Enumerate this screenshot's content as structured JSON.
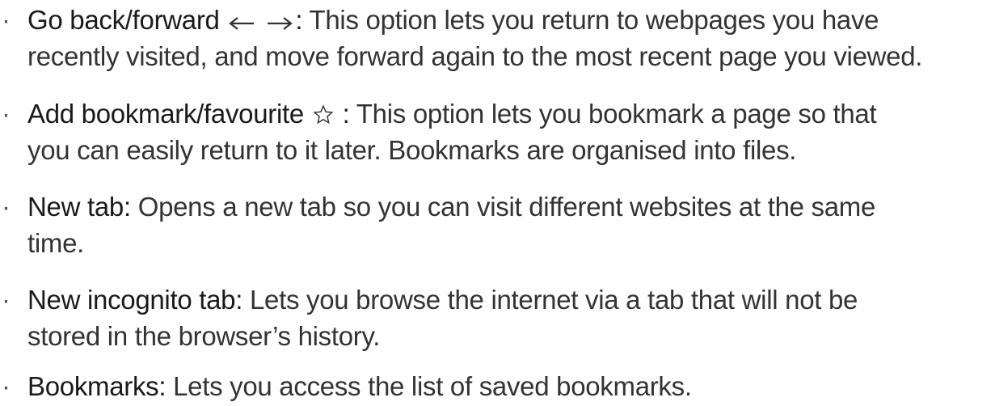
{
  "items": [
    {
      "bullet": "·",
      "term": "Go back/forward",
      "colon": ":",
      "line1": "This option lets you return to webpages you have",
      "line2": "recently visited, and move forward again to the most recent page you viewed.",
      "icons": [
        "arrow-left-icon",
        "arrow-right-icon"
      ]
    },
    {
      "bullet": "·",
      "term": "Add bookmark/favourite",
      "colon": ":",
      "line1": "This option lets you bookmark a page so that",
      "line2": "you can easily return to it later. Bookmarks are organised into files.",
      "icons": [
        "star-outline-icon"
      ]
    },
    {
      "bullet": "·",
      "term": "New tab:",
      "line1": "Opens a new tab so you can visit different websites at the same",
      "line2": "time."
    },
    {
      "bullet": "·",
      "term": "New incognito tab:",
      "line1": "Lets you browse the internet via a tab that will not be",
      "line2": "stored in the browser’s history."
    },
    {
      "bullet": "·",
      "term": "Bookmarks:",
      "line1": "Lets you access the list of saved bookmarks."
    }
  ]
}
